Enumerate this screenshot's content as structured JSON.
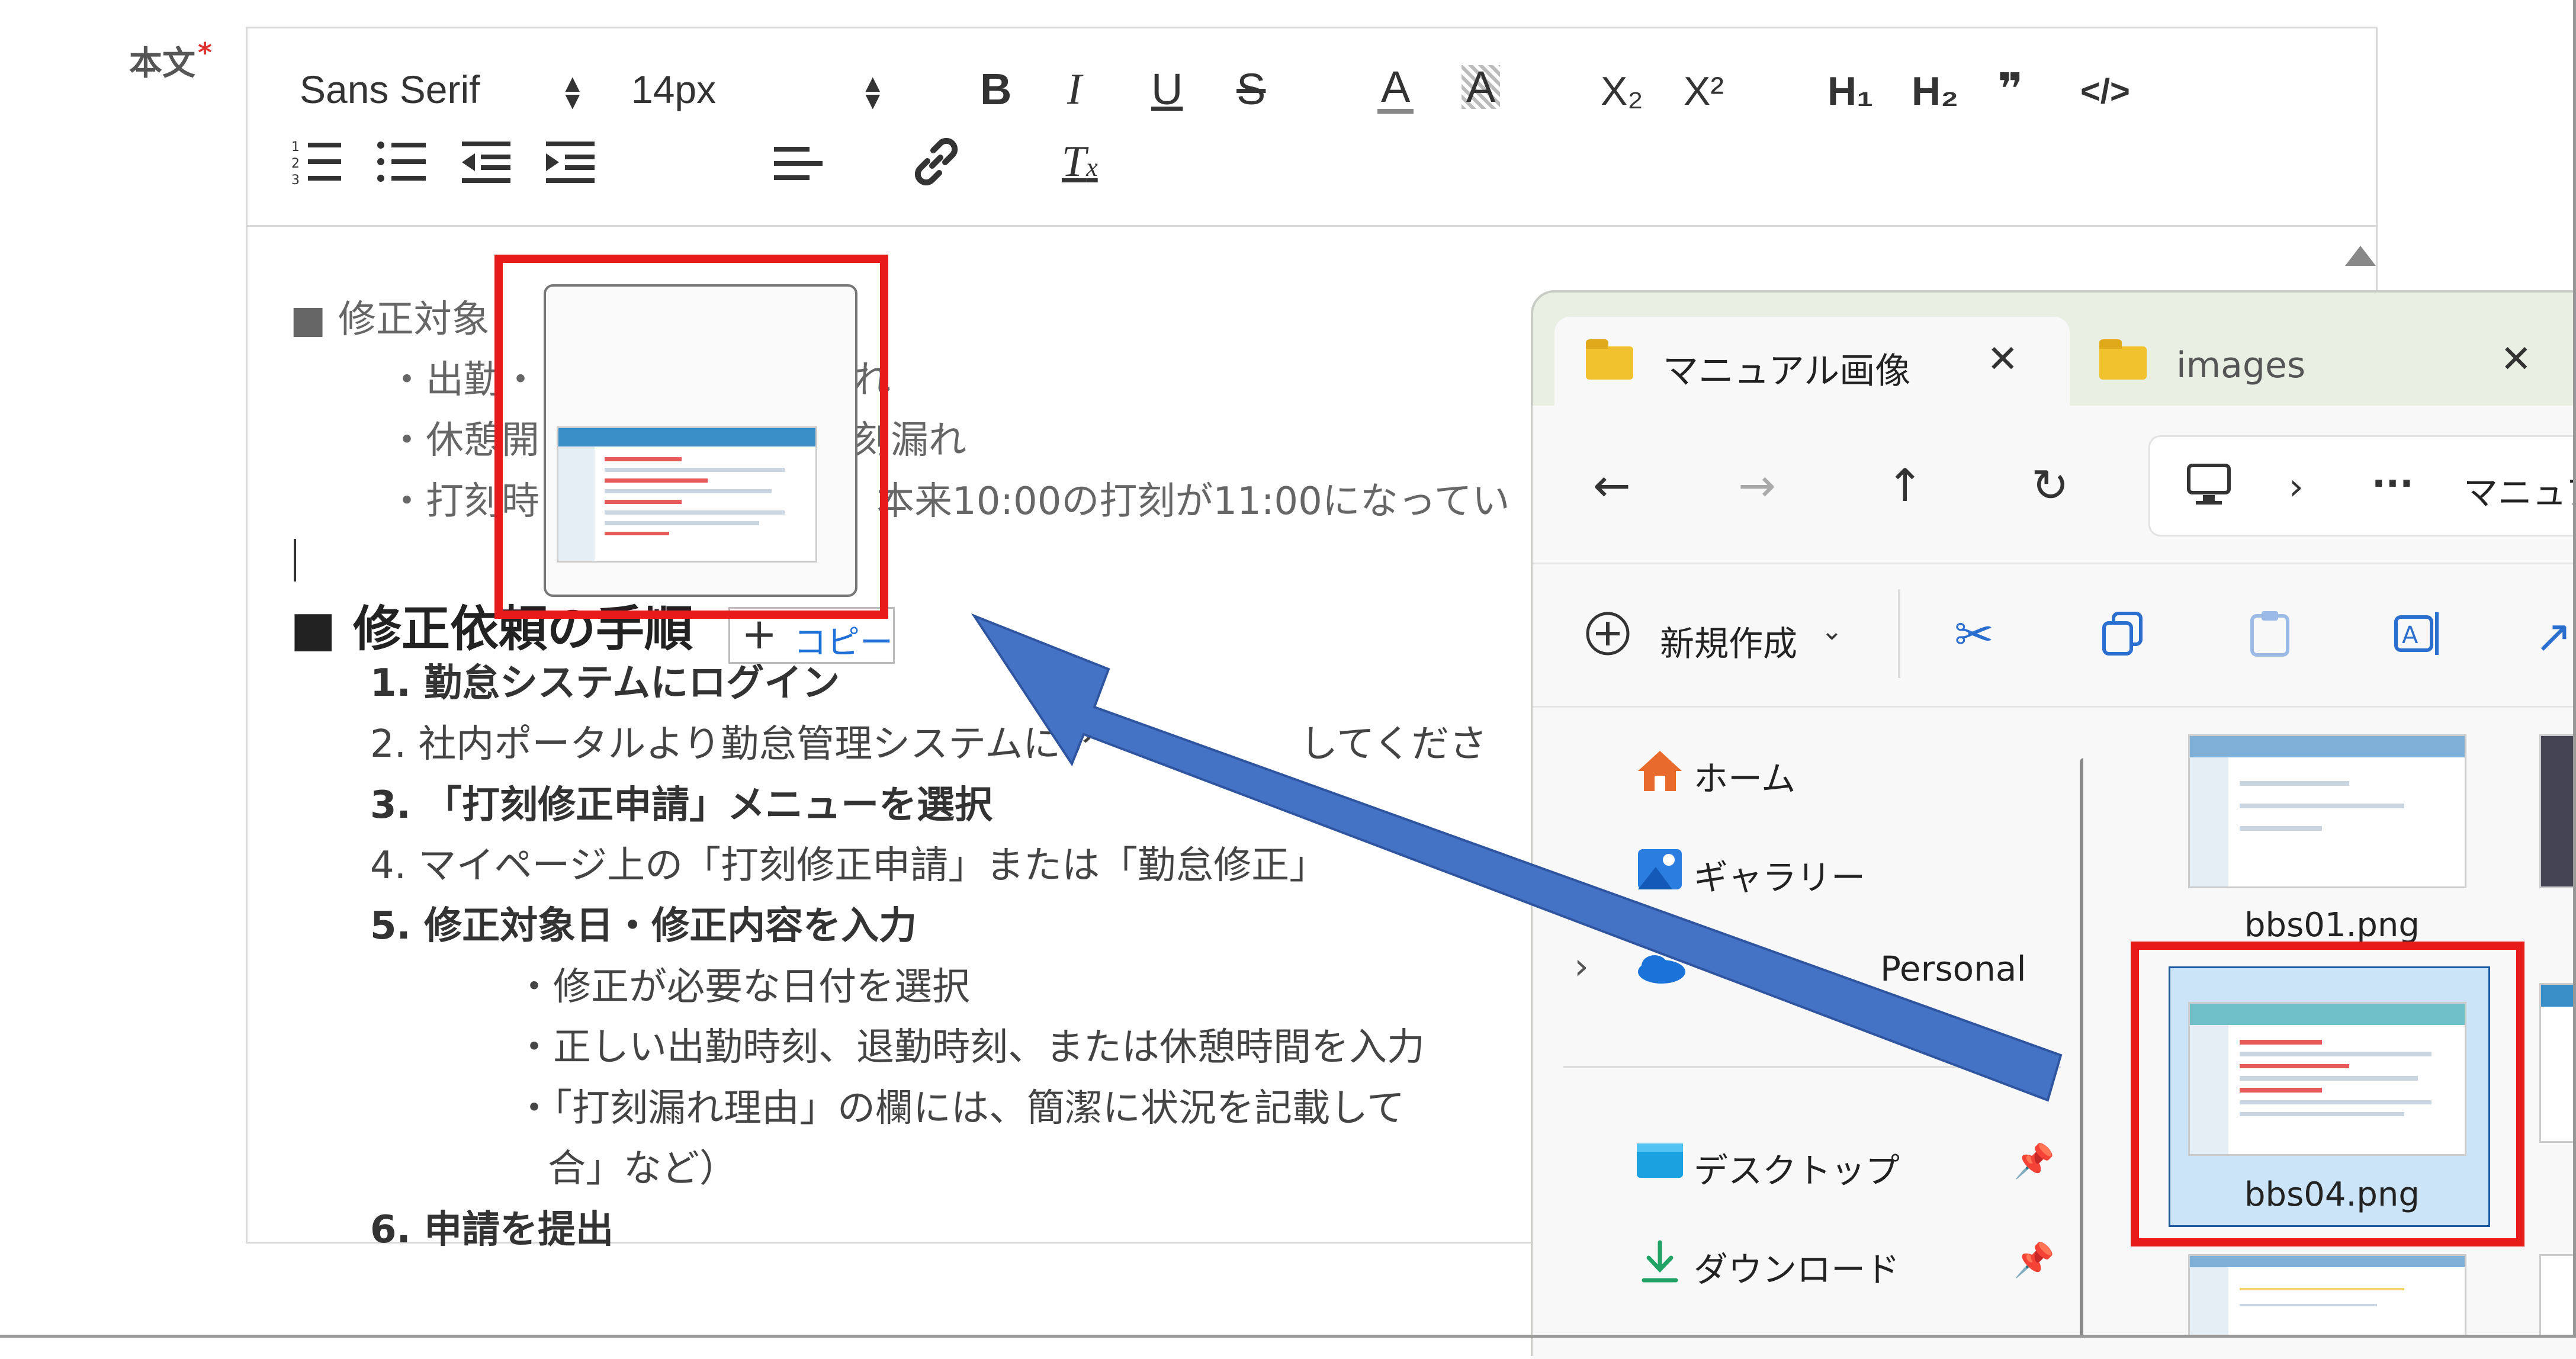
{
  "field": {
    "label": "本文",
    "required_mark": "*"
  },
  "toolbar": {
    "font_family": "Sans Serif",
    "font_size": "14px",
    "bold": "B",
    "italic": "I",
    "underline": "U",
    "strike": "S",
    "color": "A",
    "background": "A",
    "subscript": "X₂",
    "superscript": "X²",
    "h1": "H₁",
    "h2": "H₂",
    "quote": "❞",
    "code": "</>"
  },
  "content": {
    "line1": "■ 修正対象",
    "line2": "・出勤・",
    "line2b": "れ",
    "line3": "・休憩開",
    "line3b": "刻漏れ",
    "line4": "・打刻時",
    "line4b": "本来10:00の打刻が11:00になってい",
    "heading": "■ 修正依頼の手順",
    "step1": "1. 勤怠システムにログイン",
    "step2": "2. 社内ポータルより勤怠管理システムにア",
    "step2b": "してくださ",
    "step3": "3. 「打刻修正申請」メニューを選択",
    "step4": "4. マイページ上の「打刻修正申請」または「勤怠修正」",
    "step5": "5. 修正対象日・修正内容を入力",
    "sub1": "・修正が必要な日付を選択",
    "sub2": "・正しい出勤時刻、退勤時刻、または休憩時間を入力",
    "sub3": "・「打刻漏れ理由」の欄には、簡潔に状況を記載して",
    "sub3b": "合」など）",
    "step6": "6. 申請を提出"
  },
  "drag": {
    "copy_label": "コピー",
    "plus": "+"
  },
  "explorer": {
    "tabs": [
      {
        "label": "マニュアル画像"
      },
      {
        "label": "images"
      }
    ],
    "address_text": "マニュア",
    "new_label": "新規作成",
    "nav": [
      {
        "label": "ホーム"
      },
      {
        "label": "ギャラリー"
      },
      {
        "label": "Personal"
      },
      {
        "label": "デスクトップ"
      },
      {
        "label": "ダウンロード"
      }
    ],
    "files": [
      {
        "name": "bbs01.png"
      },
      {
        "name": "bbs04.png"
      }
    ]
  },
  "colors": {
    "annotation_red": "#e81b1b",
    "arrow_blue": "#4472c4",
    "selection_bg": "#cce4f7"
  }
}
